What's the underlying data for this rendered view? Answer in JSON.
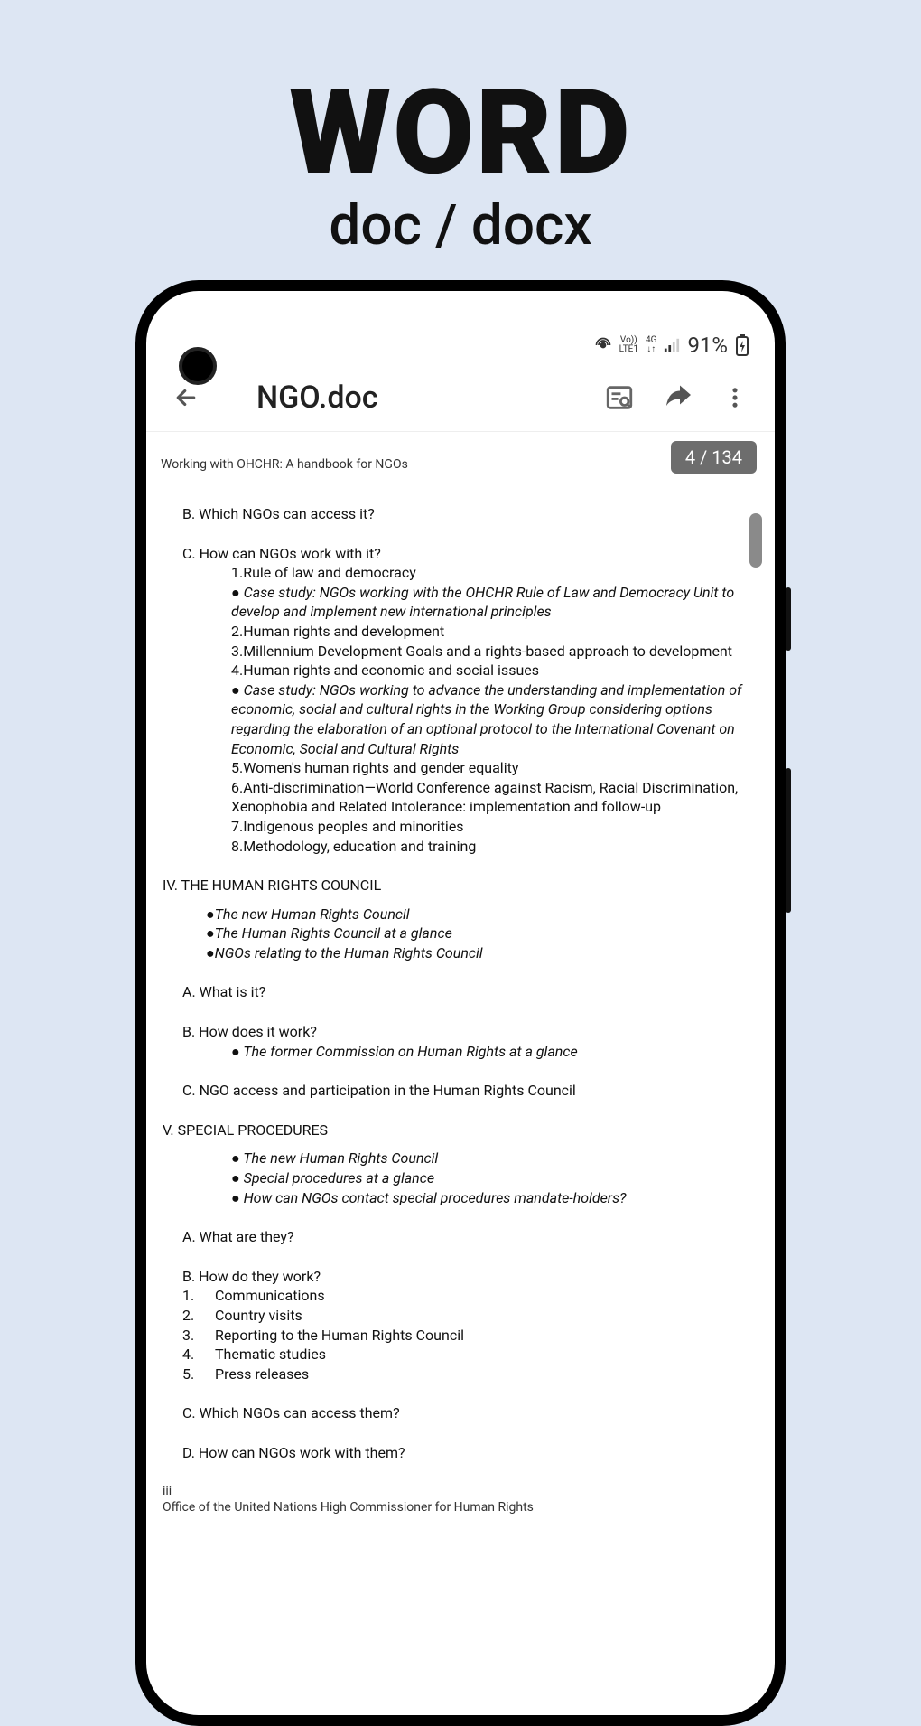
{
  "promo": {
    "title": "WORD",
    "subtitle": "doc / docx"
  },
  "status": {
    "net1": "Vo))",
    "net1b": "LTE1",
    "net2": "4G",
    "net2b": "↓↑",
    "battery": "91%"
  },
  "appbar": {
    "title": "NGO.doc"
  },
  "page_indicator": "4 / 134",
  "doc": {
    "running_head": "Working with OHCHR: A handbook for NGOs",
    "sec_b": "B. Which NGOs can access it?",
    "sec_c": "C. How can NGOs work with it?",
    "c_items": [
      "1.Rule of law and democracy",
      "● Case study: NGOs working with the OHCHR Rule of Law and Democracy Unit to develop and implement new international principles",
      "2.Human rights and development",
      "3.Millennium Development Goals and a rights-based approach to development",
      "4.Human rights and economic and social issues",
      "● Case study: NGOs working to advance the understanding and implementation of economic, social and cultural rights in the Working Group considering options regarding the elaboration of an optional protocol to the International Covenant on Economic, Social and Cultural Rights",
      "5.Women's human rights and gender equality",
      "6.Anti-discrimination—World Conference against Racism, Racial Discrimination, Xenophobia and Related Intolerance: implementation and follow-up",
      "7.Indigenous peoples and minorities",
      "8.Methodology, education and training"
    ],
    "sec_iv": "IV. THE HUMAN RIGHTS COUNCIL",
    "iv_bullets": [
      "●The new Human Rights Council",
      "●The Human Rights Council at a glance",
      "●NGOs relating to the Human Rights Council"
    ],
    "iv_a": "A. What is it?",
    "iv_b": "B. How does it work?",
    "iv_b_sub": "● The former Commission on Human Rights at a glance",
    "iv_c": "C. NGO access and participation in the Human Rights Council",
    "sec_v": "V.  SPECIAL PROCEDURES",
    "v_bullets": [
      "● The new Human Rights Council",
      "● Special procedures at a glance",
      "● How can NGOs contact special procedures mandate-holders?"
    ],
    "v_a": "A. What are they?",
    "v_b": "B. How do they work?",
    "v_b_items": [
      {
        "n": "1.",
        "t": "Communications"
      },
      {
        "n": "2.",
        "t": "Country visits"
      },
      {
        "n": "3.",
        "t": "Reporting to the Human Rights Council"
      },
      {
        "n": "4.",
        "t": "Thematic studies"
      },
      {
        "n": "5.",
        "t": "Press releases"
      }
    ],
    "v_c": "C. Which NGOs can access them?",
    "v_d": "D. How can NGOs work with them?",
    "footer_page": "iii",
    "footer_org": "Office of the United Nations High Commissioner for Human Rights"
  }
}
